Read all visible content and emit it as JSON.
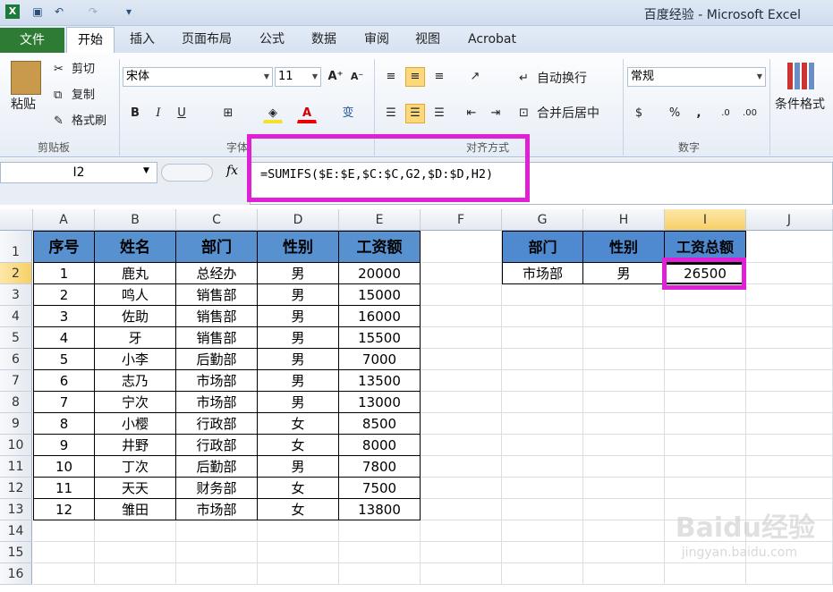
{
  "titlebar": {
    "title": "百度经验 - Microsoft Excel"
  },
  "tabs": {
    "file": "文件",
    "home": "开始",
    "insert": "插入",
    "layout": "页面布局",
    "formulas": "公式",
    "data": "数据",
    "review": "审阅",
    "view": "视图",
    "acrobat": "Acrobat"
  },
  "clipboard": {
    "paste": "粘贴",
    "cut": "剪切",
    "copy": "复制",
    "format_painter": "格式刷",
    "group": "剪贴板"
  },
  "font": {
    "name": "宋体",
    "size": "11",
    "group": "字体",
    "bold": "B",
    "italic": "I",
    "underline": "U"
  },
  "alignment": {
    "wrap": "自动换行",
    "merge": "合并后居中",
    "group": "对齐方式"
  },
  "number": {
    "format": "常规",
    "group": "数字",
    "percent": "%",
    "comma": ","
  },
  "styles": {
    "conditional": "条件格式"
  },
  "formula_bar": {
    "name_box": "I2",
    "fx": "fx",
    "formula": "=SUMIFS($E:$E,$C:$C,G2,$D:$D,H2)"
  },
  "columns": [
    "A",
    "B",
    "C",
    "D",
    "E",
    "F",
    "G",
    "H",
    "I",
    "J"
  ],
  "rows": [
    "1",
    "2",
    "3",
    "4",
    "5",
    "6",
    "7",
    "8",
    "9",
    "10",
    "11",
    "12",
    "13",
    "14",
    "15",
    "16"
  ],
  "table": {
    "headers": [
      "序号",
      "姓名",
      "部门",
      "性别",
      "工资额"
    ],
    "data": [
      [
        "1",
        "鹿丸",
        "总经办",
        "男",
        "20000"
      ],
      [
        "2",
        "鸣人",
        "销售部",
        "男",
        "15000"
      ],
      [
        "3",
        "佐助",
        "销售部",
        "男",
        "16000"
      ],
      [
        "4",
        "牙",
        "销售部",
        "男",
        "15500"
      ],
      [
        "5",
        "小李",
        "后勤部",
        "男",
        "7000"
      ],
      [
        "6",
        "志乃",
        "市场部",
        "男",
        "13500"
      ],
      [
        "7",
        "宁次",
        "市场部",
        "男",
        "13000"
      ],
      [
        "8",
        "小樱",
        "行政部",
        "女",
        "8500"
      ],
      [
        "9",
        "井野",
        "行政部",
        "女",
        "8000"
      ],
      [
        "10",
        "丁次",
        "后勤部",
        "男",
        "7800"
      ],
      [
        "11",
        "天天",
        "财务部",
        "女",
        "7500"
      ],
      [
        "12",
        "雏田",
        "市场部",
        "女",
        "13800"
      ]
    ]
  },
  "summary": {
    "headers": [
      "部门",
      "性别",
      "工资总额"
    ],
    "values": [
      "市场部",
      "男",
      "26500"
    ]
  },
  "colors": {
    "header_fill": "#5891d0",
    "highlight": "#e020d4",
    "file_tab": "#2e7b33"
  },
  "watermark": {
    "text": "Baidu经验",
    "sub": "jingyan.baidu.com"
  }
}
